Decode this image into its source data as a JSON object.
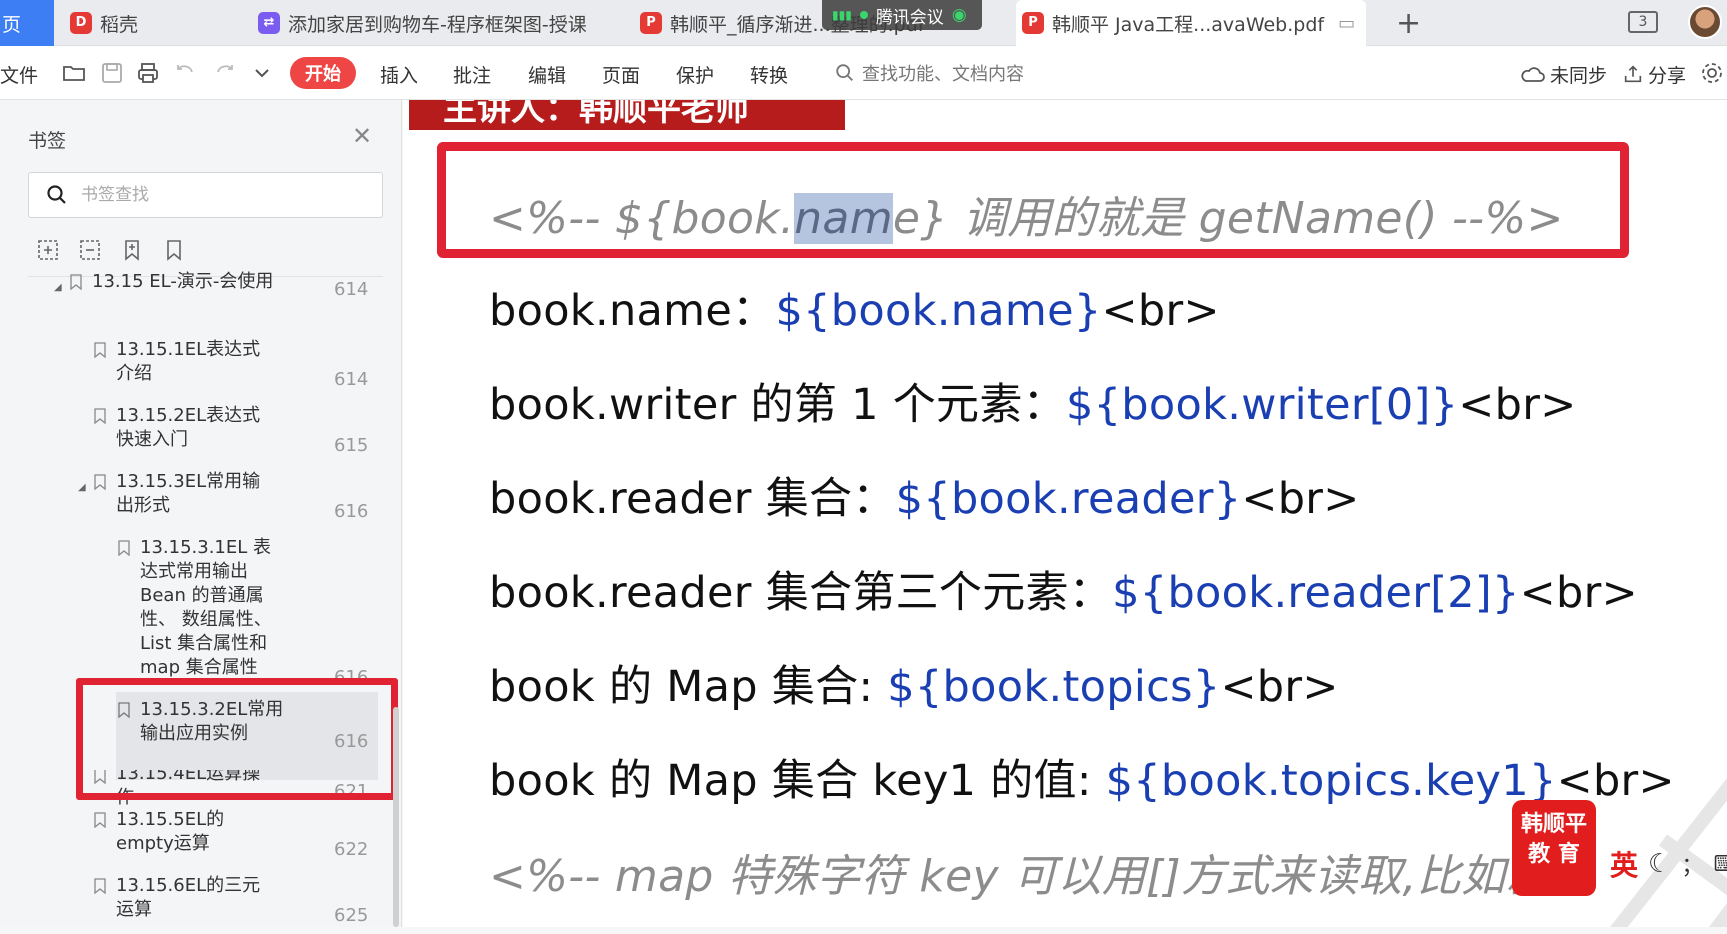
{
  "tabs": {
    "home": "页",
    "t1": "稻壳",
    "t2": "添加家居到购物车-程序框架图-授课",
    "t3": "韩顺平_循序渐进...整理的.pdf",
    "t4": "韩顺平 Java工程...avaWeb.pdf",
    "meeting": "腾讯会议",
    "count": "3"
  },
  "toolbar": {
    "file": "文件",
    "start": "开始",
    "insert": "插入",
    "annotate": "批注",
    "edit": "编辑",
    "page": "页面",
    "protect": "保护",
    "convert": "转换",
    "search_placeholder": "查找功能、文档内容",
    "sync": "未同步",
    "share": "分享"
  },
  "sidebar": {
    "title": "书签",
    "search_placeholder": "书签查找",
    "bookmarks": [
      {
        "label": "13.15 EL-演示-会使用",
        "page": "614"
      },
      {
        "label": "13.15.1EL表达式介绍",
        "page": "614"
      },
      {
        "label": "13.15.2EL表达式快速入门",
        "page": "615"
      },
      {
        "label": "13.15.3EL常用输出形式",
        "page": "616"
      },
      {
        "label": "13.15.3.1EL 表达式常用输出 Bean 的普通属性、 数组属性、List 集合属性和map 集合属性",
        "page": "616"
      },
      {
        "label": "13.15.3.2EL常用输出应用实例",
        "page": "616"
      },
      {
        "label": "13.15.4EL运算操作",
        "page": "621"
      },
      {
        "label": "13.15.5EL的empty运算",
        "page": "622"
      },
      {
        "label": "13.15.6EL的三元运算",
        "page": "625"
      }
    ]
  },
  "doc": {
    "banner": "主讲人：韩顺平老师",
    "comment1_pre": "<%-- ${book.",
    "comment1_sel": "nam",
    "comment1_post": "e}  调用的就是 getName() --%>",
    "lines": [
      {
        "text": "book.name：",
        "code": "${book.name}",
        "tail": "<br>"
      },
      {
        "text": "book.writer 的第 1 个元素：",
        "code": "${book.writer[0]}",
        "tail": "<br>"
      },
      {
        "text": "book.reader  集合：",
        "code": "${book.reader}",
        "tail": "<br>"
      },
      {
        "text": "book.reader  集合第三个元素：",
        "code": "${book.reader[2]}",
        "tail": "<br>"
      },
      {
        "text": "book 的 Map 集合: ",
        "code": "${book.topics}",
        "tail": "<br>"
      },
      {
        "text": "book 的 Map 集合 key1 的值: ",
        "code": "${book.topics.key1}",
        "tail": "<br>"
      }
    ],
    "comment2": "<%-- map 特殊字符 key 可以用[]方式来读取,比如就"
  },
  "overlay": {
    "logo_line1": "韩顺平",
    "logo_line2": "教 育",
    "ime_lang": "英",
    "ime_punct": "；"
  },
  "colors": {
    "accent_red": "#e12232",
    "code_blue": "#1a3fb2",
    "tab_active_blue": "#3d7ef5"
  }
}
